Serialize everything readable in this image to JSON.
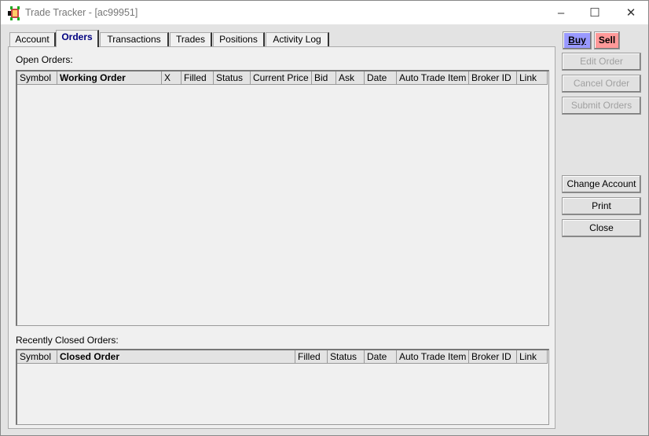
{
  "window": {
    "title": "Trade Tracker - [ac99951]",
    "app_icon": "turtle-icon",
    "controls": [
      "minimize",
      "maximize",
      "close"
    ]
  },
  "tabs": [
    {
      "label": "Account"
    },
    {
      "label": "Orders",
      "selected": true
    },
    {
      "label": "Transactions"
    },
    {
      "label": "Trades"
    },
    {
      "label": "Positions"
    },
    {
      "label": "Activity Log"
    }
  ],
  "open_orders": {
    "label": "Open Orders:",
    "columns": [
      "Symbol",
      "Working Order",
      "X",
      "Filled",
      "Status",
      "Current Price",
      "Bid",
      "Ask",
      "Date",
      "Auto Trade Item",
      "Broker ID",
      "Link"
    ],
    "rows": []
  },
  "closed_orders": {
    "label": "Recently Closed Orders:",
    "columns": [
      "Symbol",
      "Closed Order",
      "Filled",
      "Status",
      "Date",
      "Auto Trade Item",
      "Broker ID",
      "Link"
    ],
    "rows": []
  },
  "buttons": {
    "buy": "Buy",
    "sell": "Sell",
    "edit_order": "Edit Order",
    "cancel_order": "Cancel Order",
    "submit_orders": "Submit Orders",
    "change_account": "Change Account",
    "print": "Print",
    "close": "Close"
  },
  "colors": {
    "buy": "#9999ff",
    "sell": "#ff9999",
    "selected_tab_text": "#000080"
  }
}
